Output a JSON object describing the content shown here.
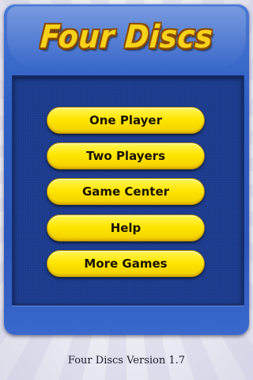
{
  "title": "Four Discs",
  "menu": {
    "items": [
      {
        "label": "One Player"
      },
      {
        "label": "Two Players"
      },
      {
        "label": "Game Center"
      },
      {
        "label": "Help"
      },
      {
        "label": "More Games"
      }
    ]
  },
  "footer": {
    "version": "Four Discs Version 1.7"
  },
  "colors": {
    "board": "#2f5fc4",
    "panel": "#1f3f94",
    "button": "#ffe600",
    "title": "#f7d21a"
  }
}
